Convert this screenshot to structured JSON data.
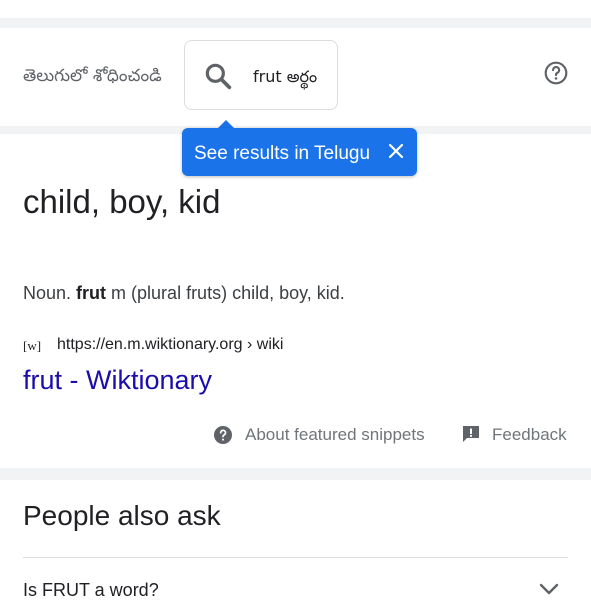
{
  "telugu_search": {
    "label": "తెలుగులో శోధించండి",
    "query": "frut అర్థం"
  },
  "tooltip": {
    "text": "See results in Telugu"
  },
  "featured_snippet": {
    "answer": "child, boy, kid",
    "definition_prefix": "Noun. ",
    "definition_term": "frut",
    "definition_rest": " m (plural fruts) child, boy, kid.",
    "favicon_text": "[w]",
    "source_url": "https://en.m.wiktionary.org › wiki",
    "link_title": "frut - Wiktionary",
    "about_label": "About featured snippets",
    "feedback_label": "Feedback"
  },
  "people_also_ask": {
    "heading": "People also ask",
    "questions": [
      "Is FRUT a word?"
    ]
  },
  "icons": [
    "menu-icon",
    "search-icon",
    "help-icon",
    "close-icon",
    "about-icon",
    "feedback-icon",
    "chevron-down-icon"
  ],
  "colors": {
    "accent": "#1a73e8",
    "link": "#1a0dab",
    "divider": "#f1f3f4"
  }
}
